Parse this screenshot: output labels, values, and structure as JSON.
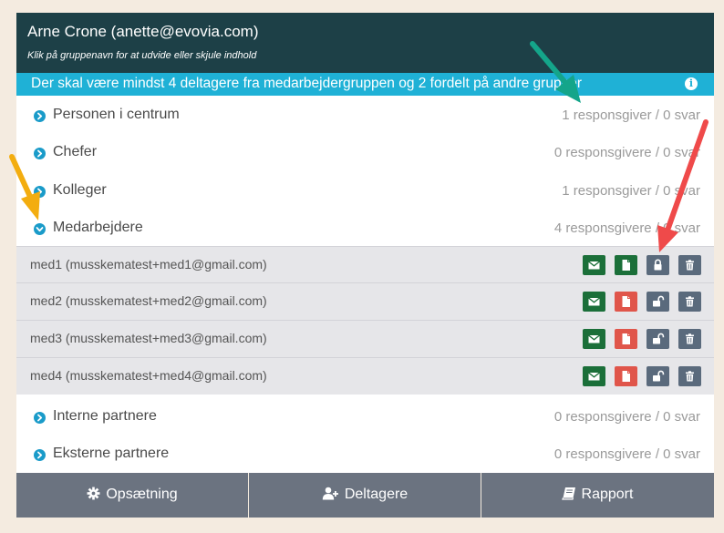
{
  "header": {
    "title": "Arne Crone (anette@evovia.com)",
    "subtitle": "Klik på gruppenavn for at udvide eller skjule indhold"
  },
  "notice": {
    "text": "Der skal være mindst 4 deltagere fra medarbejdergruppen og 2 fordelt på andre grupper",
    "icon": "info-circle-icon"
  },
  "groups": [
    {
      "name": "Personen i centrum",
      "count": "1 responsgiver / 0 svar",
      "expanded": false
    },
    {
      "name": "Chefer",
      "count": "0 responsgivere / 0 svar",
      "expanded": false
    },
    {
      "name": "Kolleger",
      "count": "1 responsgiver / 0 svar",
      "expanded": false
    },
    {
      "name": "Medarbejdere",
      "count": "4 responsgivere / 0 svar",
      "expanded": true
    },
    {
      "name": "Interne partnere",
      "count": "0 responsgivere / 0 svar",
      "expanded": false
    },
    {
      "name": "Eksterne partnere",
      "count": "0 responsgivere / 0 svar",
      "expanded": false
    }
  ],
  "members": [
    {
      "label": "med1 (musskematest+med1@gmail.com)",
      "doc_status": "submitted",
      "locked": true
    },
    {
      "label": "med2 (musskematest+med2@gmail.com)",
      "doc_status": "pending",
      "locked": false
    },
    {
      "label": "med3 (musskematest+med3@gmail.com)",
      "doc_status": "pending",
      "locked": false
    },
    {
      "label": "med4 (musskematest+med4@gmail.com)",
      "doc_status": "pending",
      "locked": false
    }
  ],
  "footer": {
    "setup": "Opsætning",
    "participants": "Deltagere",
    "report": "Rapport"
  },
  "colors": {
    "header_bg": "#1d4047",
    "notice_bg": "#1fb1d6",
    "chevron": "#1a9bc9",
    "mail_button": "#1b6f39",
    "doc_submitted": "#1b6f39",
    "doc_pending": "#e0554a",
    "lock_button": "#5a6a7c",
    "footer_bg": "#6b7380",
    "arrow_green": "#14a58a",
    "arrow_yellow": "#f3ad0f",
    "arrow_red": "#ef4a4a"
  }
}
